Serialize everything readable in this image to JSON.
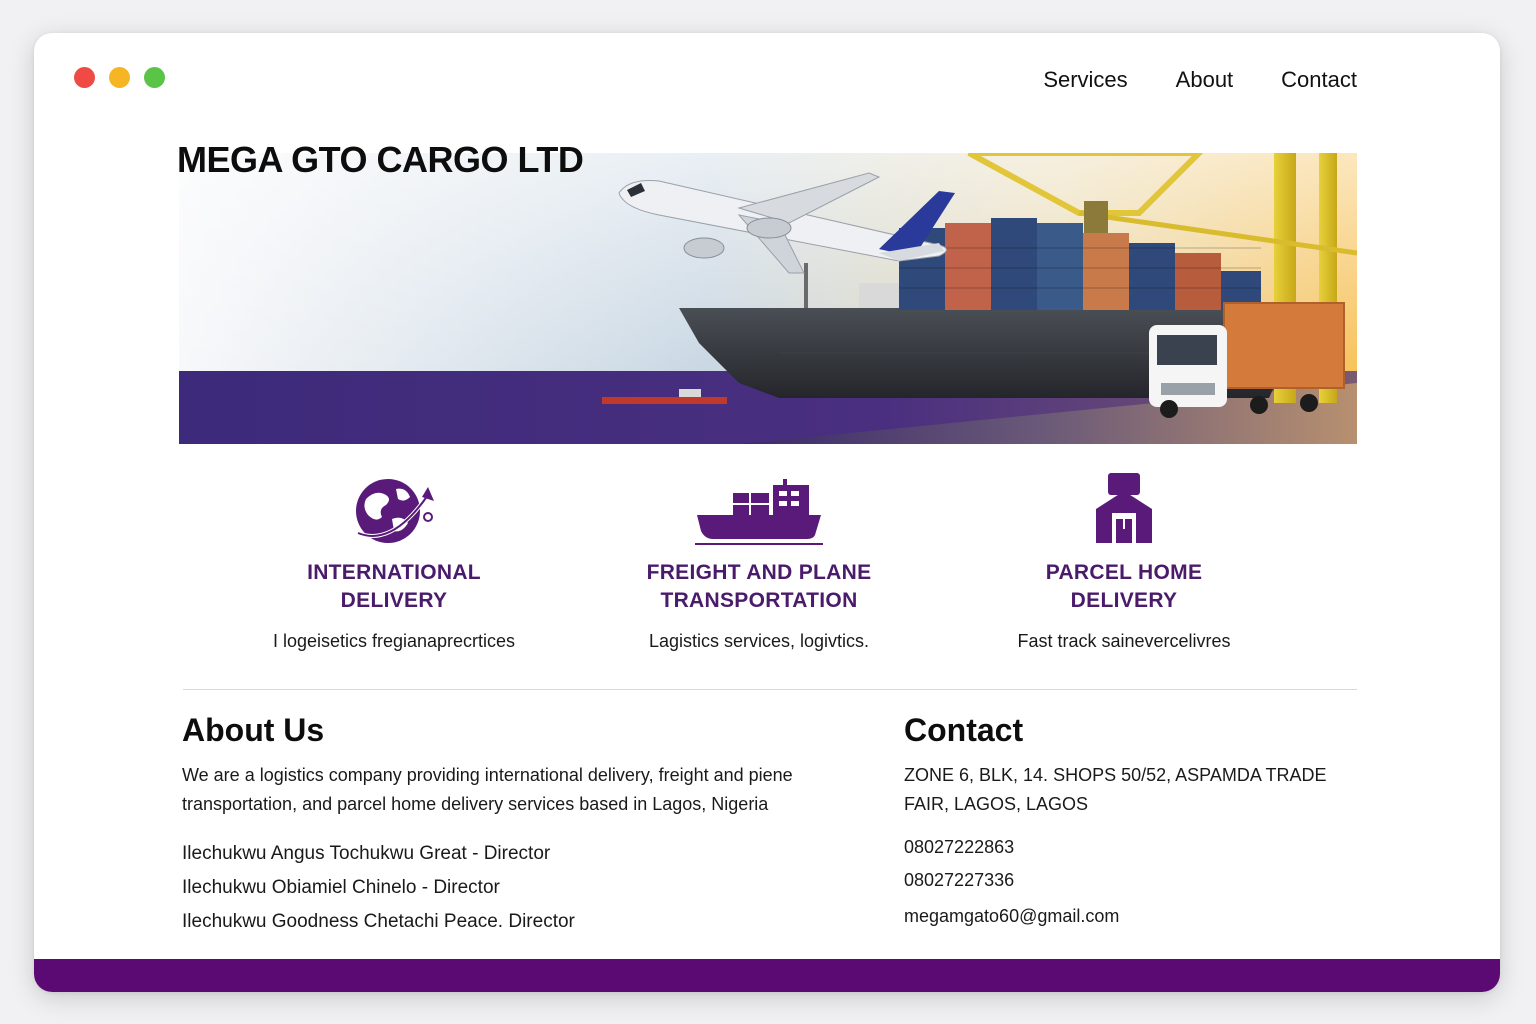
{
  "colors": {
    "brand_purple": "#5c0a73",
    "heading_purple": "#4a1a6b",
    "icon_purple": "#5a1a7a"
  },
  "window": {
    "controls": [
      "close",
      "minimize",
      "maximize"
    ]
  },
  "nav": {
    "items": [
      {
        "label": "Services"
      },
      {
        "label": "About"
      },
      {
        "label": "Contact"
      }
    ]
  },
  "brand": {
    "title": "MEGA GTO CARGO LTD"
  },
  "hero": {
    "image": "airplane-cargo-ship-truck-port"
  },
  "services": [
    {
      "icon": "globe-icon",
      "title_line1": "INTERNATIONAL",
      "title_line2": "DELIVERY",
      "description": "I logeisetics fregianаprecrtices"
    },
    {
      "icon": "cargo-ship-icon",
      "title_line1": "FREIGHT AND PLANE",
      "title_line2": "TRANSPORTATION",
      "description": "Lagistics services, logivtics."
    },
    {
      "icon": "parcel-home-icon",
      "title_line1": "PARCEL HOME",
      "title_line2": "DELIVERY",
      "description": "Fast track sainevercelivres"
    }
  ],
  "about": {
    "heading": "About Us",
    "description": "We are a logistics  company providing international delivery, freight and piene transportation, and parcel home delivery services based in Lagos, Nigeria",
    "directors": [
      "Ilechukwu Angus Tochukwu Great - Director",
      "Ilechukwu Obiamiel Chinelo - Director",
      "Ilechukwu Goodness Chetachi Peace. Director"
    ]
  },
  "contact": {
    "heading": "Contact",
    "address": "ZONE 6, BLK, 14. SHOPS 50/52, ASPAMDA TRADE FAIR, LAGOS, LAGOS",
    "phones": [
      "08027222863",
      "08027227336"
    ],
    "email": "megamgato60@gmail.com"
  }
}
